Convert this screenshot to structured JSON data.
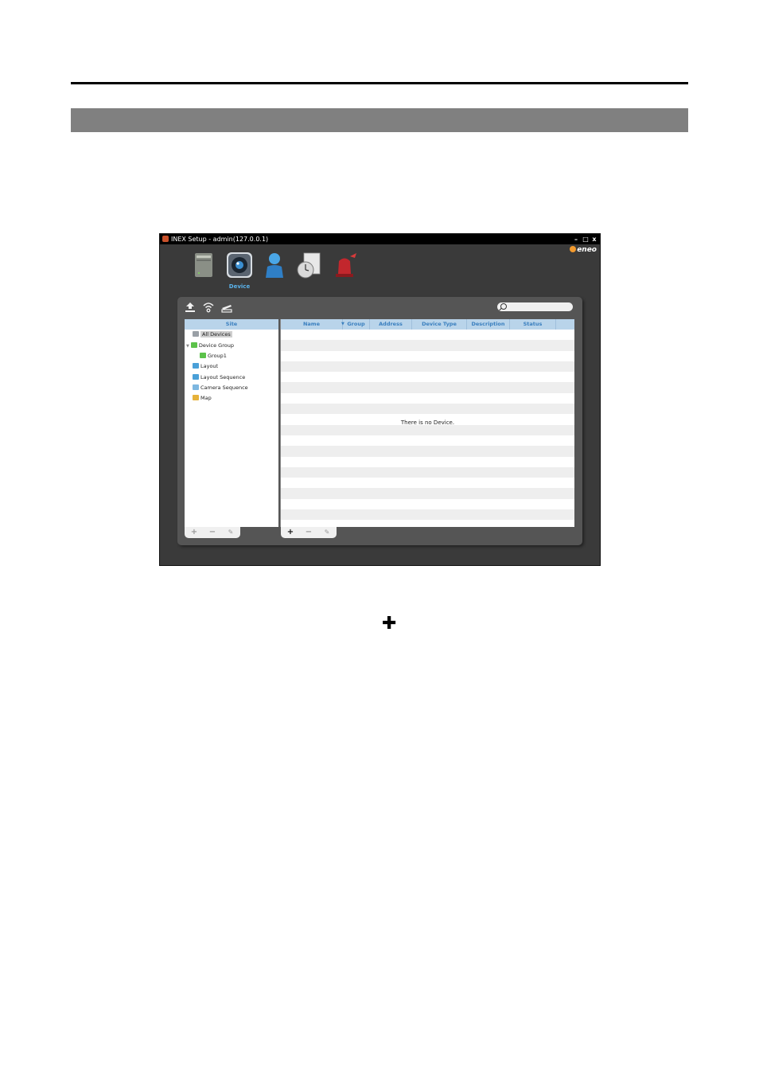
{
  "window": {
    "title": "INEX Setup - admin(127.0.0.1)",
    "controls": [
      "minimize-icon",
      "maximize-icon",
      "close-icon"
    ],
    "control_glyphs": [
      "–",
      "□",
      "x"
    ],
    "brand": "eneo"
  },
  "modules": {
    "items": [
      "server-icon",
      "device-camera-icon",
      "user-icon",
      "schedule-clock-icon",
      "alarm-siren-icon"
    ],
    "active_label": "Device"
  },
  "toolbar": {
    "icons": [
      "upload-icon",
      "wireless-scan-icon",
      "network-tool-icon"
    ],
    "search_placeholder": ""
  },
  "site_tree": {
    "header": "Site",
    "nodes": {
      "all_devices": "All Devices",
      "device_group": "Device Group",
      "group1": "Group1",
      "layout": "Layout",
      "layout_sequence": "Layout Sequence",
      "camera_sequence": "Camera Sequence",
      "map": "Map"
    }
  },
  "device_table": {
    "columns": {
      "name": "Name",
      "group": "Group",
      "address": "Address",
      "device_type": "Device Type",
      "description": "Description",
      "status": "Status"
    },
    "sort_indicator": "▼",
    "empty_message": "There is no Device."
  },
  "bottom_buttons": {
    "add": "+",
    "remove": "−",
    "edit": "✎"
  },
  "page_symbol": "✚",
  "colors": {
    "accent": "#5ab2ea",
    "header_bg": "#b9d4ea",
    "section_bar": "#808080"
  }
}
